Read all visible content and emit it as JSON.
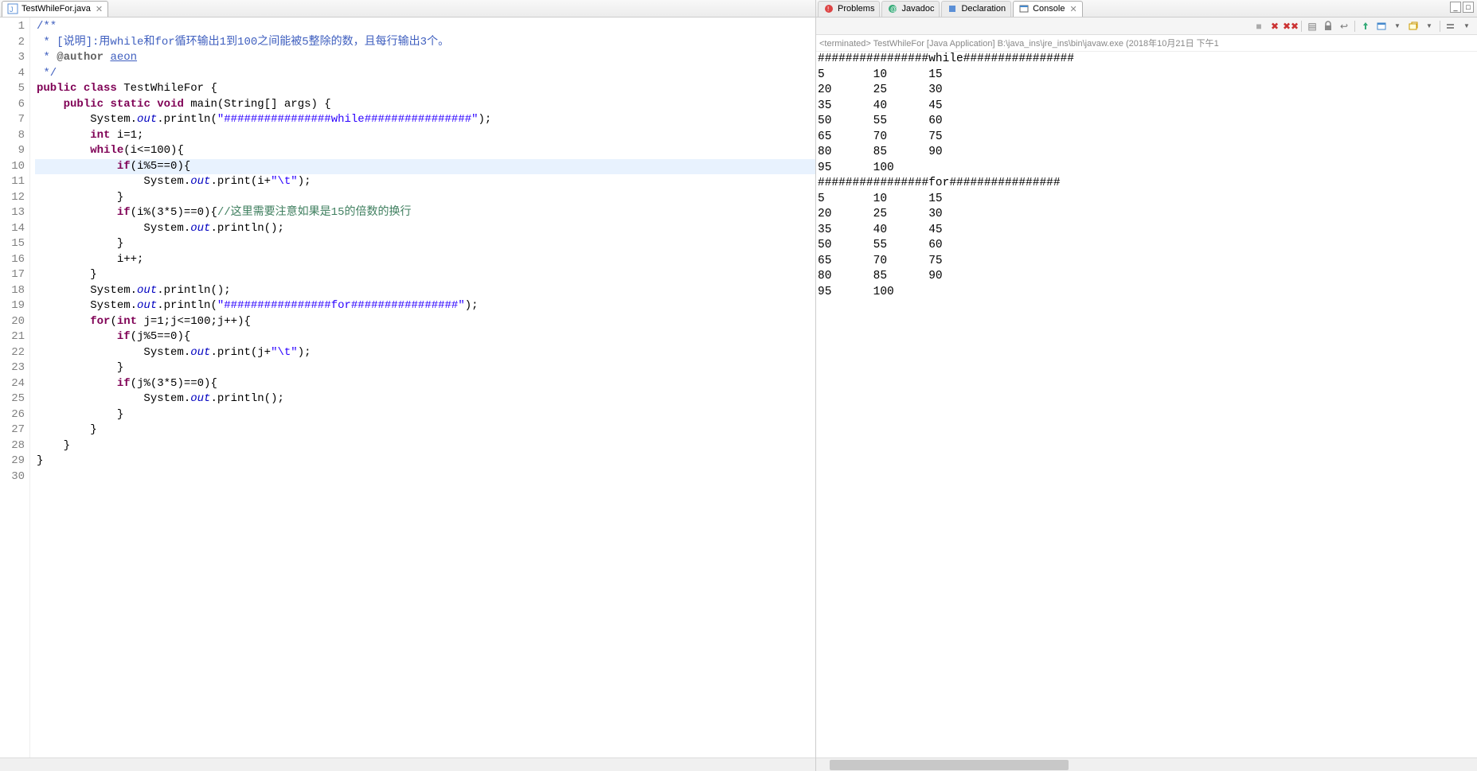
{
  "editor": {
    "tab_filename": "TestWhileFor.java",
    "tab_close": "✕",
    "lines": [
      {
        "n": 1,
        "html": "<span class='cm'>/**</span>"
      },
      {
        "n": 2,
        "html": "<span class='cm'> * [说明]:用</span><span class='cm'>while</span><span class='cm'>和</span><span class='cm'>for</span><span class='cm'>循环输出1到100之间能被5整除的数，且每行输出3个。</span>"
      },
      {
        "n": 3,
        "html": "<span class='cm'> * </span><span class='tag-hl'>@author</span><span class='cm'> </span><span class='auth'>aeon</span>"
      },
      {
        "n": 4,
        "html": "<span class='cm'> */</span>"
      },
      {
        "n": 5,
        "html": "<span class='kw'>public</span> <span class='kw'>class</span> TestWhileFor {"
      },
      {
        "n": 6,
        "html": "    <span class='kw'>public</span> <span class='kw'>static</span> <span class='kw'>void</span> main(String[] args) {"
      },
      {
        "n": 7,
        "html": "        System.<span class='fld'>out</span>.println(<span class='str'>\"################while################\"</span>);"
      },
      {
        "n": 8,
        "html": "        <span class='kw'>int</span> i=1;"
      },
      {
        "n": 9,
        "html": "        <span class='kw'>while</span>(i&lt;=100){"
      },
      {
        "n": 10,
        "hl": true,
        "html": "            <span class='kw'>if</span>(i%5==0){"
      },
      {
        "n": 11,
        "html": "                System.<span class='fld'>out</span>.print(i+<span class='str'>\"\\t\"</span>);"
      },
      {
        "n": 12,
        "html": "            }"
      },
      {
        "n": 13,
        "html": "            <span class='kw'>if</span>(i%(3*5)==0){<span class='cm-green'>//这里需要注意如果是15的倍数的换行</span>"
      },
      {
        "n": 14,
        "html": "                System.<span class='fld'>out</span>.println();"
      },
      {
        "n": 15,
        "html": "            }"
      },
      {
        "n": 16,
        "html": "            i++;"
      },
      {
        "n": 17,
        "html": "        }"
      },
      {
        "n": 18,
        "html": "        System.<span class='fld'>out</span>.println();"
      },
      {
        "n": 19,
        "html": "        System.<span class='fld'>out</span>.println(<span class='str'>\"################for################\"</span>);"
      },
      {
        "n": 20,
        "html": "        <span class='kw'>for</span>(<span class='kw'>int</span> j=1;j&lt;=100;j++){"
      },
      {
        "n": 21,
        "html": "            <span class='kw'>if</span>(j%5==0){"
      },
      {
        "n": 22,
        "html": "                System.<span class='fld'>out</span>.print(j+<span class='str'>\"\\t\"</span>);"
      },
      {
        "n": 23,
        "html": "            }"
      },
      {
        "n": 24,
        "html": "            <span class='kw'>if</span>(j%(3*5)==0){"
      },
      {
        "n": 25,
        "html": "                System.<span class='fld'>out</span>.println();"
      },
      {
        "n": 26,
        "html": "            }"
      },
      {
        "n": 27,
        "html": "        }"
      },
      {
        "n": 28,
        "html": "    }"
      },
      {
        "n": 29,
        "html": "}"
      },
      {
        "n": 30,
        "html": ""
      }
    ]
  },
  "right_tabs": {
    "problems": "Problems",
    "javadoc": "Javadoc",
    "declaration": "Declaration",
    "console": "Console",
    "console_close": "✕"
  },
  "toolbar_icons": {
    "stop_sm": "■",
    "remove_all": "✖",
    "remove": "✖",
    "clear": "▤",
    "scroll_lock": "🔒",
    "pin": "📌",
    "display": "▭",
    "open": "▦",
    "min": "_",
    "max": "□"
  },
  "console": {
    "status": "<terminated> TestWhileFor [Java Application] B:\\java_ins\\jre_ins\\bin\\javaw.exe (2018年10月21日 下午1",
    "output": "################while################\n5\t10\t15\n20\t25\t30\n35\t40\t45\n50\t55\t60\n65\t70\t75\n80\t85\t90\n95\t100\n################for################\n5\t10\t15\n20\t25\t30\n35\t40\t45\n50\t55\t60\n65\t70\t75\n80\t85\t90\n95\t100"
  }
}
